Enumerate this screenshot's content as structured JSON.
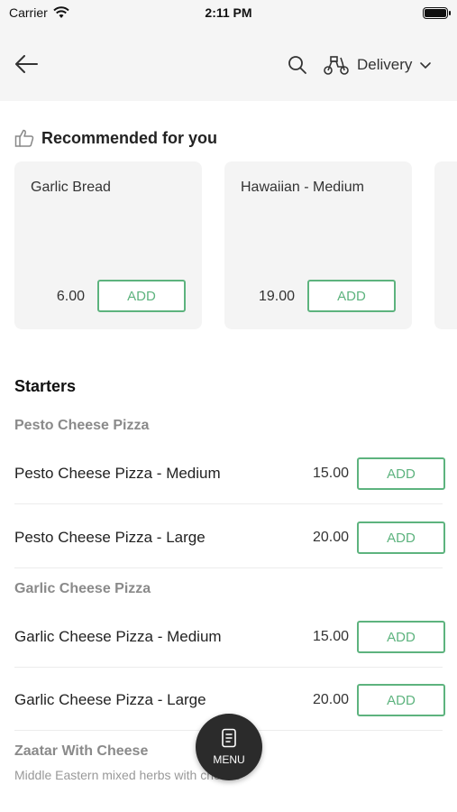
{
  "status_bar": {
    "carrier": "Carrier",
    "time": "2:11 PM"
  },
  "header": {
    "delivery_label": "Delivery",
    "icons": [
      "back-arrow-icon",
      "search-icon",
      "scooter-icon",
      "chevron-down-icon"
    ]
  },
  "recommended": {
    "title": "Recommended for you",
    "items": [
      {
        "name": "Garlic Bread",
        "price": "6.00",
        "add_label": "ADD"
      },
      {
        "name": "Hawaiian - Medium",
        "price": "19.00",
        "add_label": "ADD"
      }
    ]
  },
  "menu": {
    "section_title": "Starters",
    "groups": [
      {
        "title": "Pesto Cheese Pizza",
        "items": [
          {
            "name": "Pesto Cheese Pizza - Medium",
            "price": "15.00",
            "add_label": "ADD"
          },
          {
            "name": "Pesto Cheese Pizza - Large",
            "price": "20.00",
            "add_label": "ADD"
          }
        ]
      },
      {
        "title": "Garlic Cheese Pizza",
        "items": [
          {
            "name": "Garlic Cheese Pizza - Medium",
            "price": "15.00",
            "add_label": "ADD"
          },
          {
            "name": "Garlic Cheese Pizza - Large",
            "price": "20.00",
            "add_label": "ADD"
          }
        ]
      },
      {
        "title": "Zaatar With Cheese",
        "subtitle": "Middle Eastern mixed herbs with cheese"
      }
    ]
  },
  "fab": {
    "label": "MENU"
  },
  "colors": {
    "accent": "#5db37e",
    "header_bg": "#f5f5f5",
    "card_bg": "#f4f4f4",
    "fab_bg": "#2b2b2b"
  }
}
